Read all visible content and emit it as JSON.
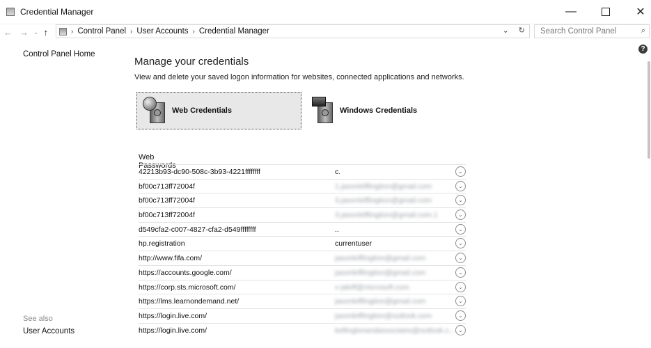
{
  "window": {
    "title": "Credential Manager",
    "minimize_glyph": "—",
    "close_glyph": "✕"
  },
  "nav": {
    "back_glyph": "←",
    "forward_glyph": "→",
    "recent_glyph": "⌄",
    "up_glyph": "↑",
    "separator": "›",
    "breadcrumbs": [
      "Control Panel",
      "User Accounts",
      "Credential Manager"
    ],
    "dropdown_glyph": "⌄",
    "refresh_glyph": "↻",
    "search_placeholder": "Search Control Panel",
    "search_glyph": "⌕"
  },
  "sidebar": {
    "home_label": "Control Panel Home",
    "see_also": "See also",
    "user_accounts": "User Accounts"
  },
  "help_glyph": "?",
  "main": {
    "heading": "Manage your credentials",
    "description": "View and delete your saved logon information for websites, connected applications and networks.",
    "web_credentials": "Web Credentials",
    "windows_credentials": "Windows Credentials",
    "section_label": "Web Passwords",
    "expand_glyph": "⌄",
    "rows": [
      {
        "name": "42213b93-dc90-508c-3b93-4221ffffffff",
        "user": "c.",
        "blurred": false
      },
      {
        "name": "bf00c713ff72004f",
        "user": "1.jasonlelflingtion@gmail.com",
        "blurred": true
      },
      {
        "name": "bf00c713ff72004f",
        "user": "3.jasonlelflingtion@gmail.com",
        "blurred": true
      },
      {
        "name": "bf00c713ff72004f",
        "user": "3.jasonlelflingtion@gmail.com.1",
        "blurred": true
      },
      {
        "name": "d549cfa2-c007-4827-cfa2-d549ffffffff",
        "user": "..",
        "blurred": false
      },
      {
        "name": "hp.registration",
        "user": "currentuser",
        "blurred": false
      },
      {
        "name": "http://www.fifa.com/",
        "user": "jasonlelflingtion@gmail.com",
        "blurred": true
      },
      {
        "name": "https://accounts.google.com/",
        "user": "jasonlelflingtion@gmail.com",
        "blurred": true
      },
      {
        "name": "https://corp.sts.microsoft.com/",
        "user": "v-jaleff@microsoft.com",
        "blurred": true
      },
      {
        "name": "https://lms.learnondemand.net/",
        "user": "jasonlelflingtion@gmail.com",
        "blurred": true
      },
      {
        "name": "https://login.live.com/",
        "user": "jasonlelflingtion@outlook.com",
        "blurred": true
      },
      {
        "name": "https://login.live.com/",
        "user": "kellinglonandassociates@outlook.c...",
        "blurred": true
      }
    ]
  }
}
